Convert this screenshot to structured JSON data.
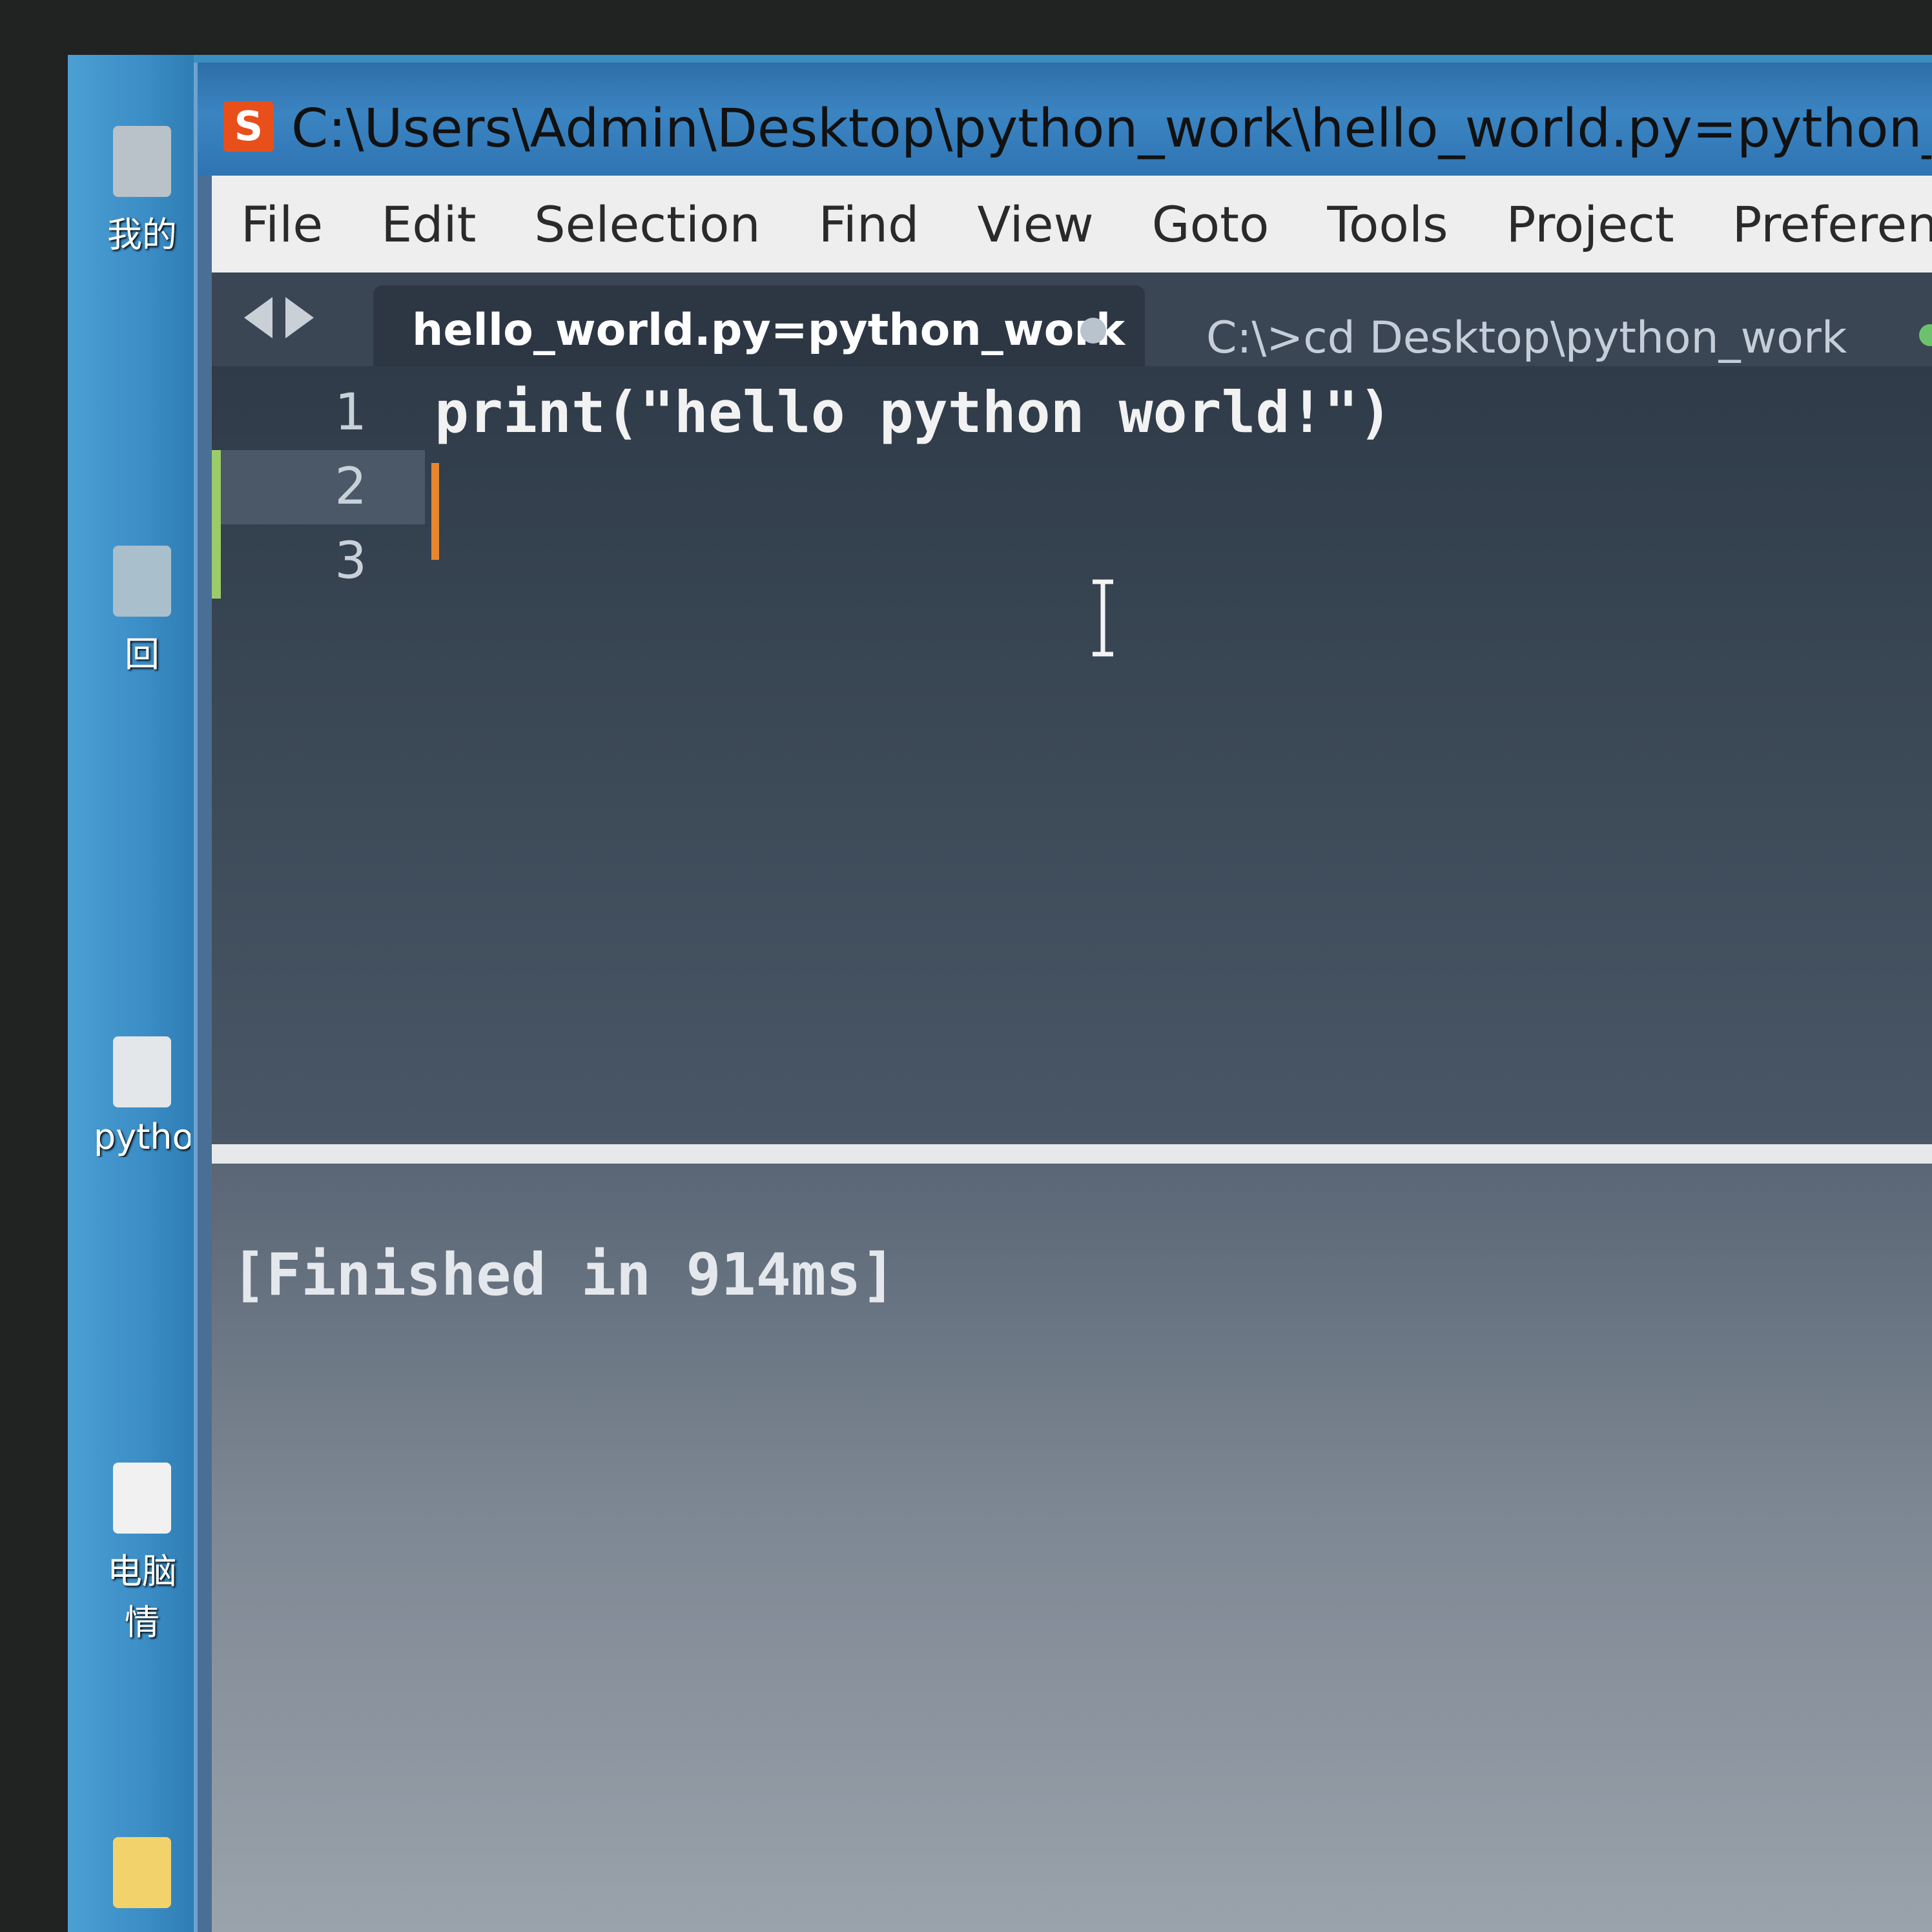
{
  "window": {
    "title": "C:\\Users\\Admin\\Desktop\\python_work\\hello_world.py=python_work -",
    "app_logo_glyph": "S"
  },
  "menu": {
    "items": [
      "File",
      "Edit",
      "Selection",
      "Find",
      "View",
      "Goto",
      "Tools",
      "Project",
      "Preference"
    ]
  },
  "tabs": {
    "active": {
      "label": "hello_world.py=python_work"
    },
    "inactive": {
      "label": "C:\\>cd Desktop\\python_work"
    }
  },
  "editor": {
    "line_numbers": [
      "1",
      "2",
      "3"
    ],
    "code_lines": [
      "print(\"hello python world!\")",
      "",
      ""
    ]
  },
  "output": {
    "text": "[Finished in 914ms]"
  },
  "desktop": {
    "icons": [
      {
        "label": "我的"
      },
      {
        "label": "回"
      },
      {
        "label": "pytho"
      },
      {
        "label": "电脑"
      },
      {
        "label": "情"
      }
    ]
  },
  "colors": {
    "accent_caret": "#e8862e",
    "logo": "#e94f1a",
    "modified_marker": "#9ccb6a"
  }
}
